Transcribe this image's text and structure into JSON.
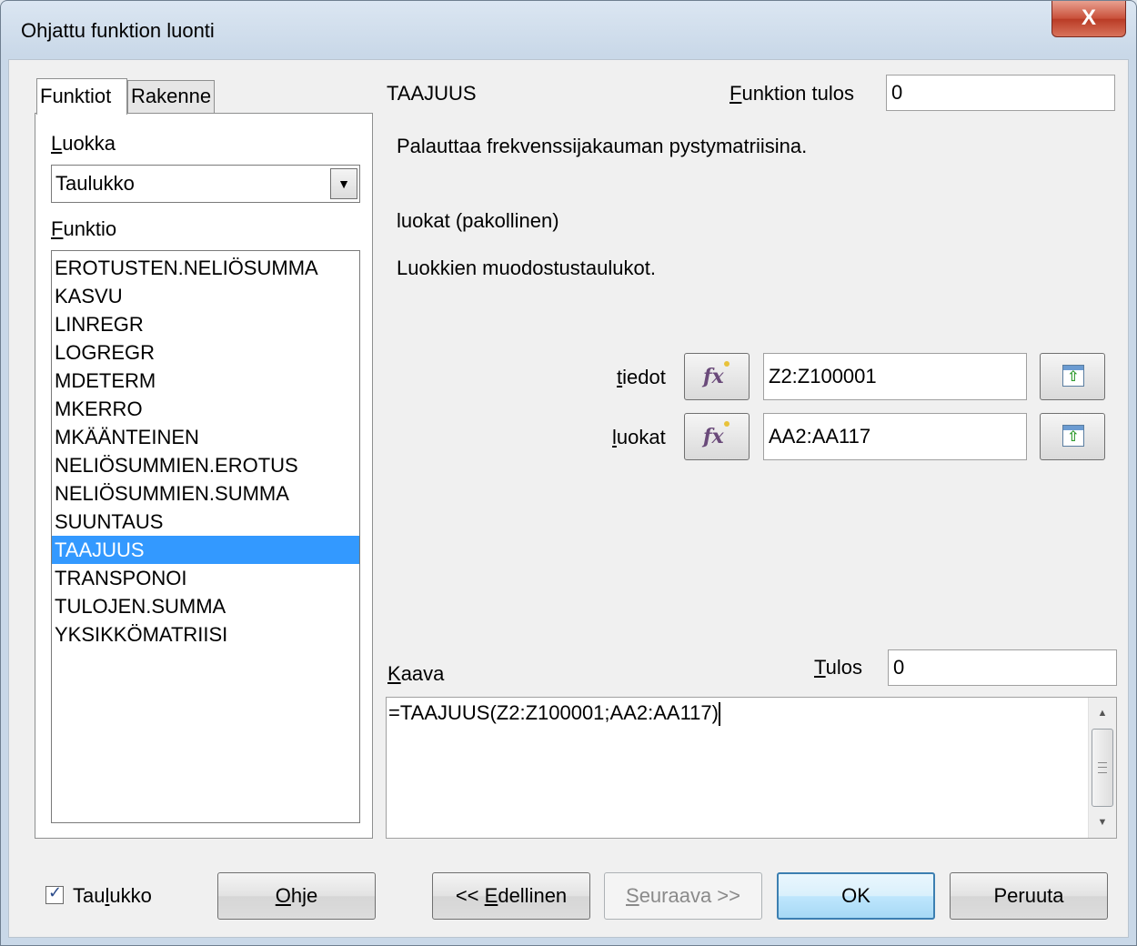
{
  "window": {
    "title": "Ohjattu funktion luonti",
    "close_label": "X"
  },
  "tabs": [
    {
      "label": "Funktiot",
      "active": true
    },
    {
      "label": "Rakenne",
      "active": false
    }
  ],
  "category": {
    "label_mnemonic": "L",
    "label_rest": "uokka",
    "value": "Taulukko"
  },
  "function_list": {
    "label_mnemonic": "F",
    "label_rest": "unktio",
    "items": [
      "EROTUSTEN.NELIÖSUMMA",
      "KASVU",
      "LINREGR",
      "LOGREGR",
      "MDETERM",
      "MKERRO",
      "MKÄÄNTEINEN",
      "NELIÖSUMMIEN.EROTUS",
      "NELIÖSUMMIEN.SUMMA",
      "SUUNTAUS",
      "TAAJUUS",
      "TRANSPONOI",
      "TULOJEN.SUMMA",
      "YKSIKKÖMATRIISI"
    ],
    "selected": "TAAJUUS"
  },
  "details": {
    "function_name": "TAAJUUS",
    "result_label_mnemonic": "F",
    "result_label_rest": "unktion tulos",
    "result_value": "0",
    "description": "Palauttaa frekvenssijakauman pystymatriisina.",
    "param_title": "luokat (pakollinen)",
    "param_description": "Luokkien muodostustaulukot."
  },
  "arguments": [
    {
      "label_mnemonic": "t",
      "label_rest": "iedot",
      "value": "Z2:Z100001",
      "fx_icon": "function-wizard-icon",
      "shrink_icon": "shrink-dialog-icon"
    },
    {
      "label_mnemonic": "l",
      "label_rest": "uokat",
      "value": "AA2:AA117",
      "fx_icon": "function-wizard-icon",
      "shrink_icon": "shrink-dialog-icon"
    }
  ],
  "formula": {
    "label_mnemonic": "K",
    "label_rest": "aava",
    "value": "=TAAJUUS(Z2:Z100001;AA2:AA117)",
    "result_label_mnemonic": "T",
    "result_label_rest": "ulos",
    "result_value": "0"
  },
  "footer": {
    "checkbox_label_pre": "Tau",
    "checkbox_label_mnemonic": "l",
    "checkbox_label_post": "ukko",
    "checkbox_checked": true,
    "help_mnemonic": "O",
    "help_rest": "hje",
    "prev_prefix": "<< ",
    "prev_mnemonic": "E",
    "prev_rest": "dellinen",
    "next_mnemonic": "S",
    "next_rest": "euraava >>",
    "ok_label": "OK",
    "cancel_label": "Peruuta"
  },
  "colors": {
    "selection": "#3399ff",
    "close_button": "#c9503a",
    "default_button_border": "#3c7fb1"
  }
}
